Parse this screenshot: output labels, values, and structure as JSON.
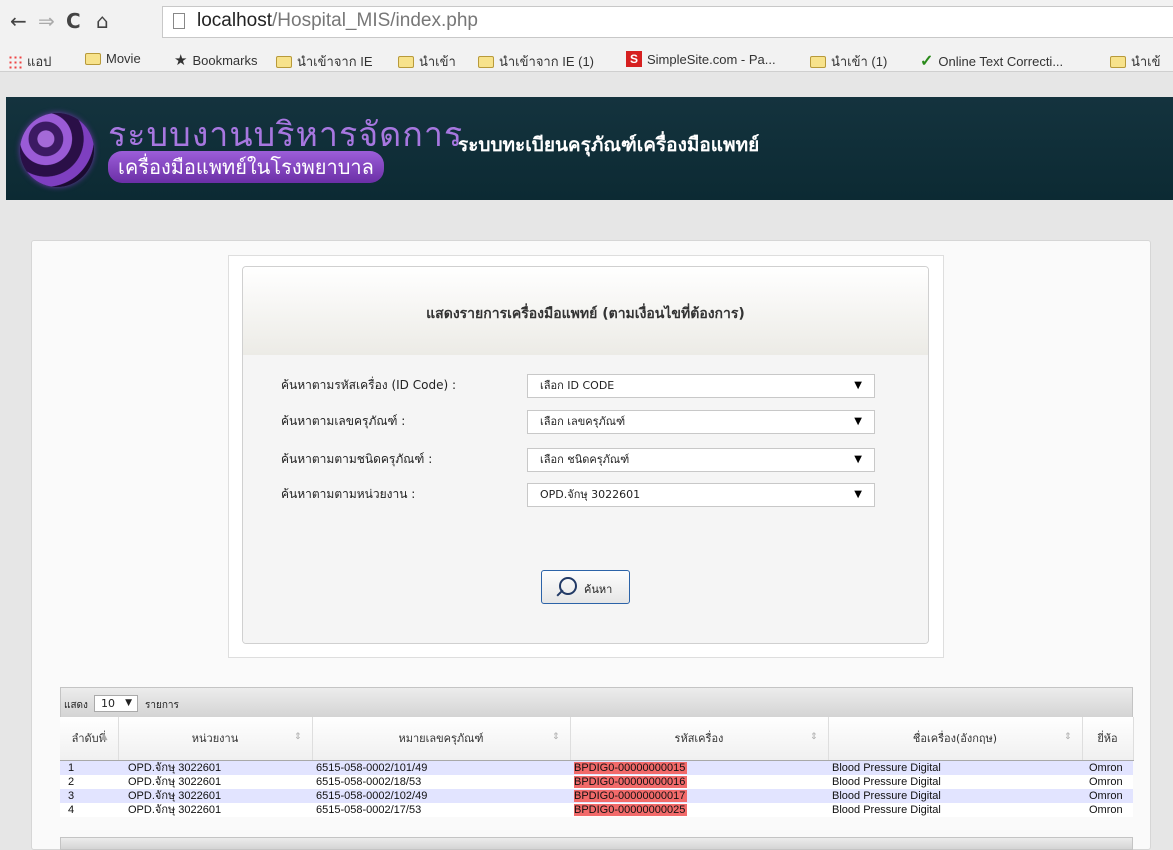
{
  "browser": {
    "url_host": "localhost",
    "url_path": "/Hospital_MIS/index.php",
    "bookmarks": [
      {
        "label": "แอป",
        "icon": "apps-grid-icon"
      },
      {
        "label": "Movie",
        "icon": "folder-icon"
      },
      {
        "label": "Bookmarks",
        "icon": "star-icon"
      },
      {
        "label": "นำเข้าจาก IE",
        "icon": "folder-icon"
      },
      {
        "label": "นำเข้า",
        "icon": "folder-icon"
      },
      {
        "label": "นำเข้าจาก IE (1)",
        "icon": "folder-icon"
      },
      {
        "label": "SimpleSite.com - Pa...",
        "icon": "simplesite-icon"
      },
      {
        "label": "นำเข้า (1)",
        "icon": "folder-icon"
      },
      {
        "label": "Online Text Correcti...",
        "icon": "checkmark-icon"
      },
      {
        "label": "นำเข้",
        "icon": "folder-icon"
      }
    ]
  },
  "header": {
    "logo_line1": "ระบบงานบริหารจัดการ",
    "logo_line2": "เครื่องมือแพทย์ในโรงพยาบาล",
    "system_title": "ระบบทะเบียนครุภัณฑ์เครื่องมือแพทย์"
  },
  "search": {
    "heading": "แสดงรายการเครื่องมือแพทย์ (ตามเงื่อนไขที่ต้องการ)",
    "fields": [
      {
        "label": "ค้นหาตามรหัสเครื่อง (ID Code) :",
        "value": "เลือก ID CODE"
      },
      {
        "label": "ค้นหาตามเลขครุภัณฑ์ :",
        "value": "เลือก เลขครุภัณฑ์"
      },
      {
        "label": "ค้นหาตามตามชนิดครุภัณฑ์ :",
        "value": "เลือก ชนิดครุภัณฑ์"
      },
      {
        "label": "ค้นหาตามตามหน่วยงาน :",
        "value": "OPD.จักษุ 3022601"
      }
    ],
    "button_label": "ค้นหา"
  },
  "table": {
    "show_label": "แสดง",
    "page_size": "10",
    "items_label": "รายการ",
    "columns": [
      "ลำดับที่",
      "หน่วยงาน",
      "หมายเลขครุภัณฑ์",
      "รหัสเครื่อง",
      "ชื่อเครื่อง(อังกฤษ)",
      "ยี่ห้อ"
    ],
    "rows": [
      [
        "1",
        "OPD.จักษุ 3022601",
        "6515-058-0002/101/49",
        "BPDIG0-00000000015",
        "Blood Pressure Digital",
        "Omron"
      ],
      [
        "2",
        "OPD.จักษุ 3022601",
        "6515-058-0002/18/53",
        "BPDIG0-00000000016",
        "Blood Pressure Digital",
        "Omron"
      ],
      [
        "3",
        "OPD.จักษุ 3022601",
        "6515-058-0002/102/49",
        "BPDIG0-00000000017",
        "Blood Pressure Digital",
        "Omron"
      ],
      [
        "4",
        "OPD.จักษุ 3022601",
        "6515-058-0002/17/53",
        "BPDIG0-00000000025",
        "Blood Pressure Digital",
        "Omron"
      ]
    ]
  }
}
